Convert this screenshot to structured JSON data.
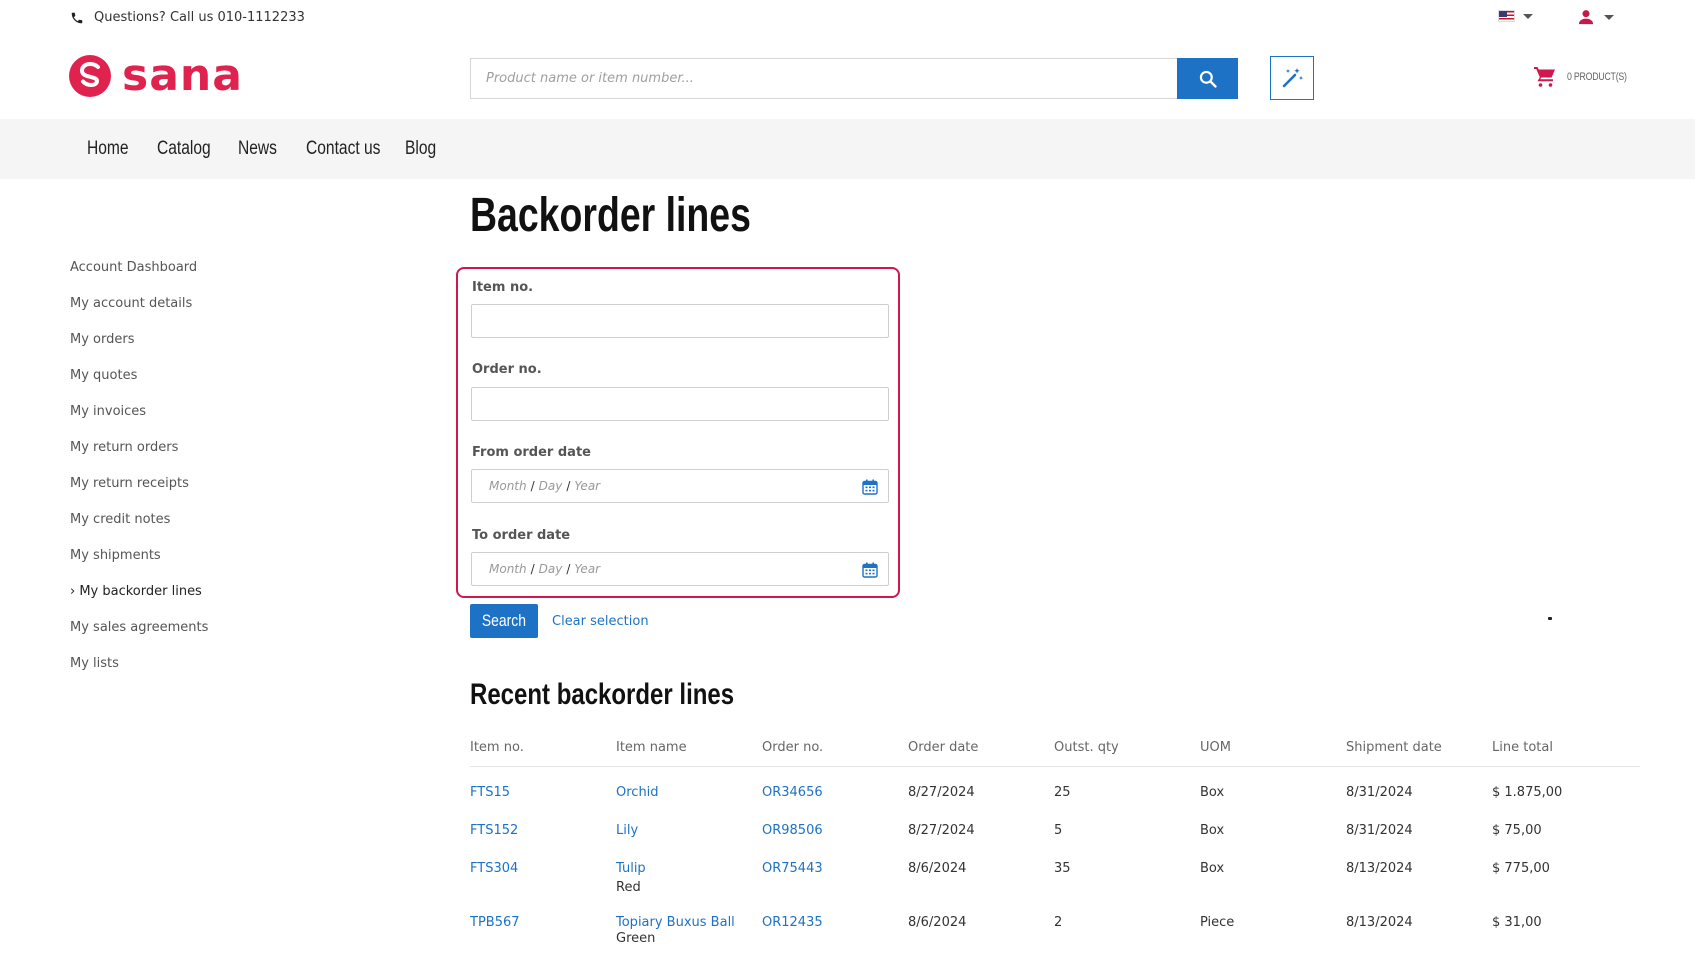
{
  "topbar": {
    "phone_text": "Questions? Call us 010-1112233",
    "flag_icon": "us-flag-icon",
    "user_icon": "user-icon"
  },
  "header": {
    "logo_text": "sana",
    "search": {
      "placeholder": "Product name or item number..."
    },
    "cart_label": "0 PRODUCT(S)"
  },
  "colors": {
    "accent": "#1d72c6",
    "brand": "#e0234e",
    "highlight_border": "#d0174f"
  },
  "nav": {
    "items": [
      {
        "label": "Home"
      },
      {
        "label": "Catalog"
      },
      {
        "label": "News"
      },
      {
        "label": "Contact us"
      },
      {
        "label": "Blog"
      }
    ]
  },
  "sidebar": {
    "items": [
      {
        "label": "Account Dashboard"
      },
      {
        "label": "My account details"
      },
      {
        "label": "My orders"
      },
      {
        "label": "My quotes"
      },
      {
        "label": "My invoices"
      },
      {
        "label": "My return orders"
      },
      {
        "label": "My return receipts"
      },
      {
        "label": "My credit notes"
      },
      {
        "label": "My shipments"
      },
      {
        "label": "› My backorder lines",
        "active": true
      },
      {
        "label": "My sales agreements"
      },
      {
        "label": "My lists"
      }
    ]
  },
  "main": {
    "title": "Backorder lines",
    "filters": {
      "item_no_label": "Item no.",
      "order_no_label": "Order no.",
      "from_date_label": "From order date",
      "to_date_label": "To order date",
      "date_placeholder": {
        "month": "Month",
        "day": "Day",
        "year": "Year",
        "sep": "/"
      }
    },
    "search_button": "Search",
    "clear_link": "Clear selection",
    "recent_title": "Recent backorder lines",
    "table": {
      "headers": [
        "Item no.",
        "Item name",
        "Order no.",
        "Order date",
        "Outst. qty",
        "UOM",
        "Shipment date",
        "Line total"
      ],
      "rows": [
        {
          "item_no": "FTS15",
          "item_name": "Orchid",
          "variant": "",
          "order_no": "OR34656",
          "order_date": "8/27/2024",
          "qty": "25",
          "uom": "Box",
          "ship_date": "8/31/2024",
          "total": "$ 1.875,00"
        },
        {
          "item_no": "FTS152",
          "item_name": "Lily",
          "variant": "",
          "order_no": "OR98506",
          "order_date": "8/27/2024",
          "qty": "5",
          "uom": "Box",
          "ship_date": "8/31/2024",
          "total": "$ 75,00"
        },
        {
          "item_no": "FTS304",
          "item_name": "Tulip",
          "variant": "Red",
          "order_no": "OR75443",
          "order_date": "8/6/2024",
          "qty": "35",
          "uom": "Box",
          "ship_date": "8/13/2024",
          "total": "$ 775,00"
        },
        {
          "item_no": "TPB567",
          "item_name": "Topiary Buxus Ball",
          "variant": "Green",
          "order_no": "OR12435",
          "order_date": "8/6/2024",
          "qty": "2",
          "uom": "Piece",
          "ship_date": "8/13/2024",
          "total": "$ 31,00"
        }
      ]
    }
  }
}
